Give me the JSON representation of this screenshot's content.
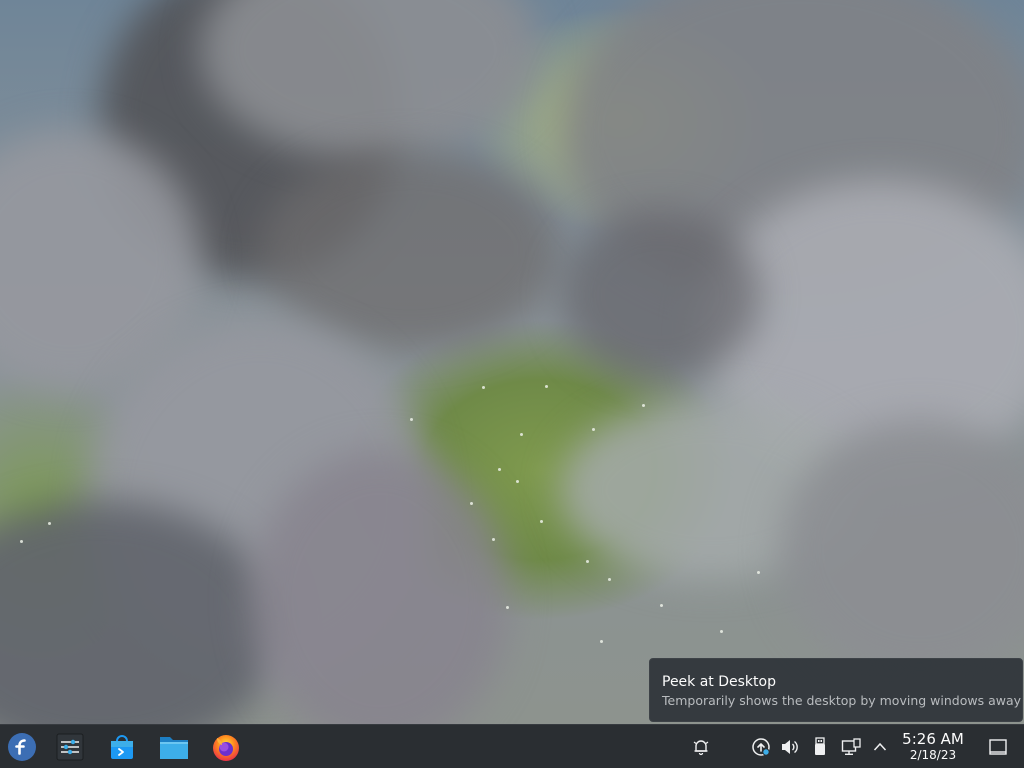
{
  "tooltip": {
    "title": "Peek at Desktop",
    "description": "Temporarily shows the desktop by moving windows away"
  },
  "taskbar": {
    "launcher_icon": "fedora-logo-icon",
    "pinned_apps": [
      {
        "icon": "system-settings-icon"
      },
      {
        "icon": "discover-store-icon"
      },
      {
        "icon": "file-manager-folder-icon"
      },
      {
        "icon": "firefox-icon"
      }
    ],
    "tray": [
      {
        "icon": "notifications-bell-icon"
      },
      {
        "icon": "updates-icon"
      },
      {
        "icon": "volume-icon"
      },
      {
        "icon": "removable-device-icon"
      },
      {
        "icon": "network-wired-icon"
      },
      {
        "icon": "show-hidden-icons-chevron-icon"
      }
    ],
    "clock": {
      "time": "5:26 AM",
      "date": "2/18/23"
    },
    "show_desktop_icon": "show-desktop-icon"
  },
  "colors": {
    "panel": "#2a2e32",
    "accent_blue": "#3daee9",
    "fedora_blue": "#3c6eb4"
  }
}
